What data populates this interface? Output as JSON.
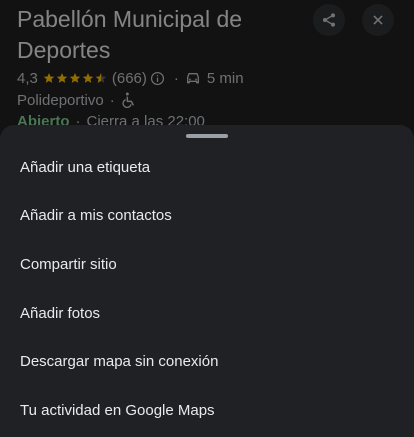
{
  "place": {
    "name": "Pabellón Municipal de Deportes",
    "rating": "4,3",
    "stars_filled": 4.3,
    "review_count": "(666)",
    "travel_time": "5 min",
    "category": "Polideportivo",
    "separator": "·",
    "open_status": "Abierto",
    "closing_text": "Cierra a las 22:00"
  },
  "icons": {
    "share": "share-icon",
    "close": "close-icon",
    "info": "info-icon",
    "car": "car-icon",
    "accessible": "wheelchair-icon"
  },
  "colors": {
    "background": "#1f1f1f",
    "sheet": "#202124",
    "star": "#fbbc04",
    "open": "#81c995",
    "text": "#e8eaed"
  },
  "menu": {
    "items": [
      {
        "label": "Añadir una etiqueta"
      },
      {
        "label": "Añadir a mis contactos"
      },
      {
        "label": "Compartir sitio"
      },
      {
        "label": "Añadir fotos"
      },
      {
        "label": "Descargar mapa sin conexión"
      },
      {
        "label": "Tu actividad en Google Maps"
      }
    ]
  }
}
